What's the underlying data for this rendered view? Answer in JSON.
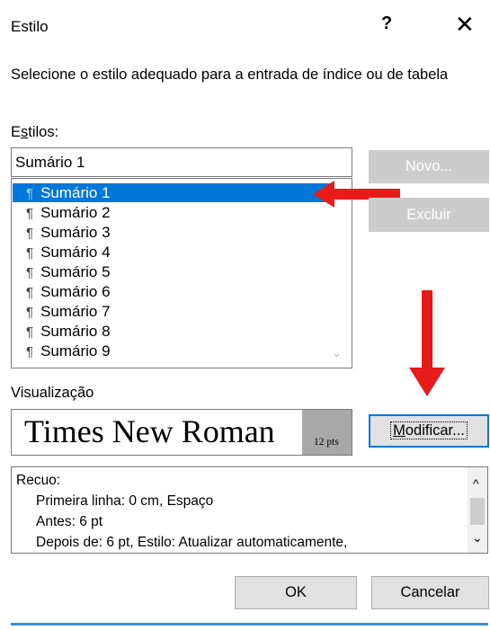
{
  "dialog": {
    "title": "Estilo",
    "help_label": "?",
    "close_label": "✕",
    "description": "Selecione o estilo adequado para a entrada de índice ou de tabela"
  },
  "styles": {
    "label_prefix": "E",
    "label_underlined": "s",
    "label_suffix": "tilos:",
    "current_value": "Sumário 1",
    "pilcrow": "¶",
    "items": [
      "Sumário 1",
      "Sumário 2",
      "Sumário 3",
      "Sumário 4",
      "Sumário 5",
      "Sumário 6",
      "Sumário 7",
      "Sumário 8",
      "Sumário 9"
    ],
    "selected_index": 0,
    "scroll_down_glyph": "⌄"
  },
  "buttons": {
    "new_label": "Novo...",
    "delete_label": "Excluir",
    "modify_prefix": "",
    "modify_underlined": "M",
    "modify_suffix": "odificar...",
    "ok_label": "OK",
    "cancel_label": "Cancelar"
  },
  "preview": {
    "label": "Visualização",
    "font_name": "Times New Roman",
    "font_size": "12 pts"
  },
  "details": {
    "lines": [
      "Recuo:",
      "Primeira linha:  0 cm, Espaço",
      "Antes:  6 pt",
      "Depois de:  6 pt, Estilo: Atualizar automaticamente,"
    ],
    "scroll_up_glyph": "^",
    "scroll_down_glyph": "⌄"
  },
  "colors": {
    "selection": "#0078d7",
    "arrow": "#e81b1b",
    "disabled_button": "#cccccc",
    "accent_line": "#3c8fd4"
  }
}
